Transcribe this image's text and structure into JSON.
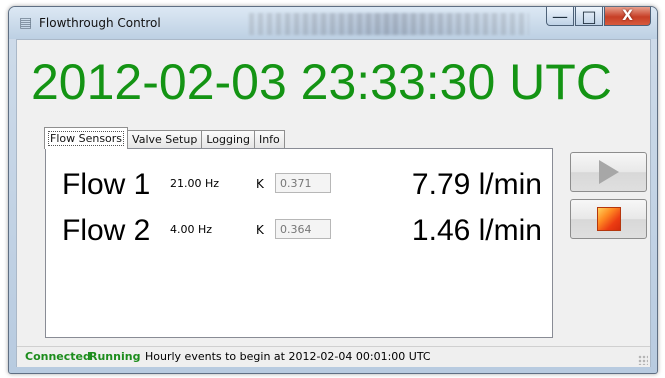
{
  "window": {
    "title": "Flowthrough Control",
    "icon": "app-window-icon",
    "controls": {
      "minimize": "—",
      "maximize": "□",
      "close": "X"
    }
  },
  "clock": "2012-02-03 23:33:30 UTC",
  "tabs": [
    {
      "label": "Flow Sensors",
      "active": true
    },
    {
      "label": "Valve Setup",
      "active": false
    },
    {
      "label": "Logging",
      "active": false
    },
    {
      "label": "Info",
      "active": false
    }
  ],
  "flows": [
    {
      "name": "Flow 1",
      "hz": "21.00 Hz",
      "k_label": "K",
      "k_value": "0.371",
      "rate": "7.79 l/min"
    },
    {
      "name": "Flow 2",
      "hz": "4.00 Hz",
      "k_label": "K",
      "k_value": "0.364",
      "rate": "1.46 l/min"
    }
  ],
  "buttons": {
    "start_icon": "play-icon",
    "stop_icon": "stop-icon"
  },
  "status": {
    "connected": "Connected",
    "running": "Running",
    "message": "Hourly events to begin at 2012-02-04 00:01:00 UTC"
  },
  "colors": {
    "clock": "#149414",
    "status_green": "#1d8d1d",
    "close_button": "#c73f26"
  }
}
